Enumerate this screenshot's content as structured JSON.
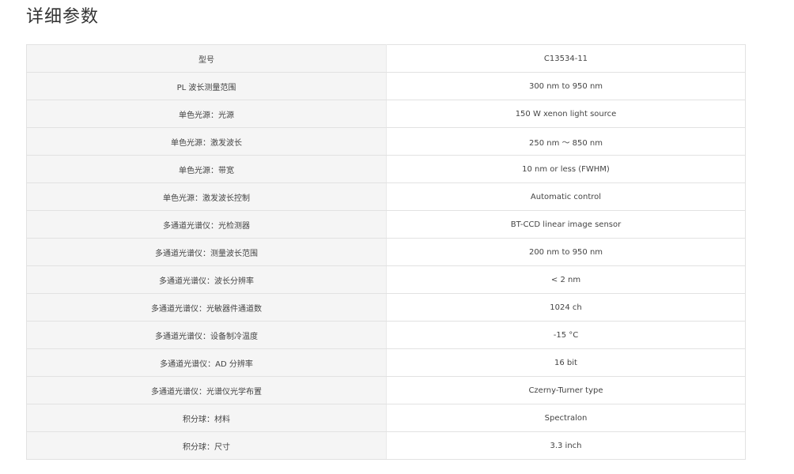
{
  "page": {
    "title": "详细参数"
  },
  "specs": {
    "rows": [
      {
        "label": "型号",
        "value": "C13534-11"
      },
      {
        "label": "PL 波长测量范围",
        "value": "300 nm to 950 nm"
      },
      {
        "label": "单色光源：光源",
        "value": "150 W xenon light source"
      },
      {
        "label": "单色光源：激发波长",
        "value": "250 nm ～ 850 nm"
      },
      {
        "label": "单色光源：带宽",
        "value": "10 nm or less (FWHM)"
      },
      {
        "label": "单色光源：激发波长控制",
        "value": "Automatic control"
      },
      {
        "label": "多通道光谱仪：光检测器",
        "value": "BT-CCD linear image sensor"
      },
      {
        "label": "多通道光谱仪：测量波长范围",
        "value": "200 nm to 950 nm"
      },
      {
        "label": "多通道光谱仪：波长分辨率",
        "value": "< 2 nm"
      },
      {
        "label": "多通道光谱仪：光敏器件通道数",
        "value": "1024 ch"
      },
      {
        "label": "多通道光谱仪：设备制冷温度",
        "value": "-15 °C"
      },
      {
        "label": "多通道光谱仪：AD 分辨率",
        "value": "16 bit"
      },
      {
        "label": "多通道光谱仪：光谱仪光学布置",
        "value": "Czerny-Turner type"
      },
      {
        "label": "积分球：材料",
        "value": "Spectralon"
      },
      {
        "label": "积分球：尺寸",
        "value": "3.3 inch"
      }
    ]
  }
}
